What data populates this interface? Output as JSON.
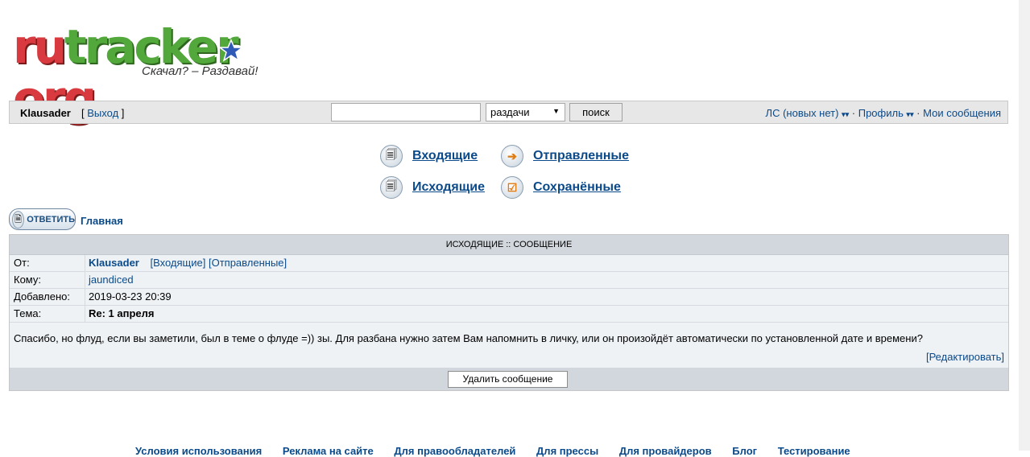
{
  "logo": {
    "part1": "ru",
    "part2": "tracker",
    "part3": "org",
    "tagline": "Скачал? – Раздавай!",
    "colors": {
      "red": "#d93a3f",
      "green": "#52a83a",
      "star": "#2f5bb7"
    }
  },
  "topbar": {
    "username": "Klausader",
    "logout_prefix": "[",
    "logout_label": "Выход",
    "logout_suffix": "]",
    "search_value": "",
    "search_scope": "раздачи",
    "search_button": "поиск",
    "pm_label": "ЛС (новых нет)",
    "profile_label": "Профиль",
    "my_messages_label": "Мои сообщения",
    "separator": "·"
  },
  "folders": {
    "inbox": "Входящие",
    "sent": "Отправленные",
    "outbox": "Исходящие",
    "saved": "Сохранённые"
  },
  "actions": {
    "reply_label": "ОТВЕТИТЬ",
    "home_label": "Главная"
  },
  "message": {
    "header": "ИСХОДЯЩИЕ :: СООБЩЕНИЕ",
    "from_label": "От:",
    "from_value": "Klausader",
    "from_inbox_link": "[Входящие]",
    "from_sent_link": "[Отправленные]",
    "to_label": "Кому:",
    "to_value": "jaundiced",
    "date_label": "Добавлено:",
    "date_value": "2019-03-23 20:39",
    "subject_label": "Тема:",
    "subject_value": "Re: 1 апреля",
    "body": "Спасибо, но флуд, если вы заметили, был в теме о флуде =)) зы. Для разбана нужно затем Вам напомнить в личку, или он произойдёт автоматически по установленной дате и времени?",
    "edit_link": "[Редактировать]",
    "delete_button": "Удалить сообщение"
  },
  "footer": {
    "links": [
      "Условия использования",
      "Реклама на сайте",
      "Для правообладателей",
      "Для прессы",
      "Для провайдеров",
      "Блог",
      "Тестирование"
    ]
  }
}
